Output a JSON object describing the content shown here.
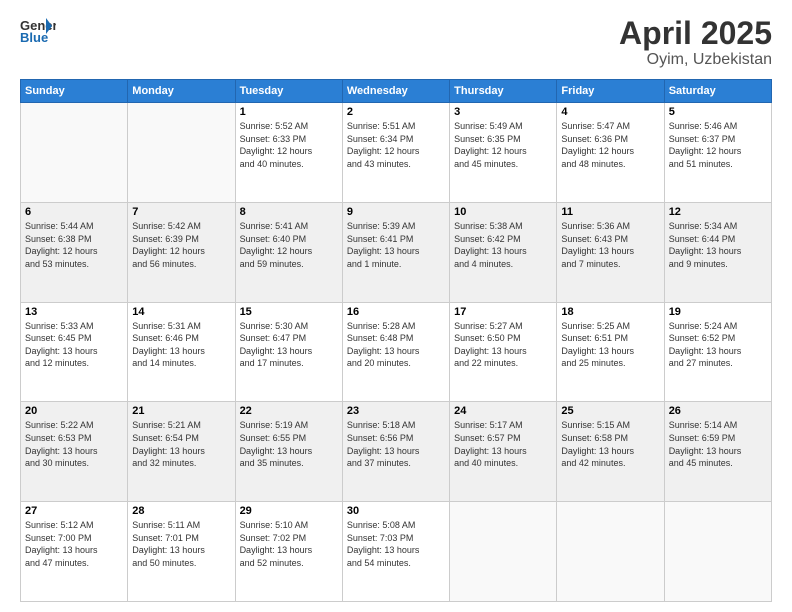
{
  "header": {
    "logo": {
      "text_general": "General",
      "text_blue": "Blue"
    },
    "title": "April 2025",
    "location": "Oyim, Uzbekistan"
  },
  "days_of_week": [
    "Sunday",
    "Monday",
    "Tuesday",
    "Wednesday",
    "Thursday",
    "Friday",
    "Saturday"
  ],
  "weeks": [
    [
      {
        "day": "",
        "info": ""
      },
      {
        "day": "",
        "info": ""
      },
      {
        "day": "1",
        "info": "Sunrise: 5:52 AM\nSunset: 6:33 PM\nDaylight: 12 hours\nand 40 minutes."
      },
      {
        "day": "2",
        "info": "Sunrise: 5:51 AM\nSunset: 6:34 PM\nDaylight: 12 hours\nand 43 minutes."
      },
      {
        "day": "3",
        "info": "Sunrise: 5:49 AM\nSunset: 6:35 PM\nDaylight: 12 hours\nand 45 minutes."
      },
      {
        "day": "4",
        "info": "Sunrise: 5:47 AM\nSunset: 6:36 PM\nDaylight: 12 hours\nand 48 minutes."
      },
      {
        "day": "5",
        "info": "Sunrise: 5:46 AM\nSunset: 6:37 PM\nDaylight: 12 hours\nand 51 minutes."
      }
    ],
    [
      {
        "day": "6",
        "info": "Sunrise: 5:44 AM\nSunset: 6:38 PM\nDaylight: 12 hours\nand 53 minutes."
      },
      {
        "day": "7",
        "info": "Sunrise: 5:42 AM\nSunset: 6:39 PM\nDaylight: 12 hours\nand 56 minutes."
      },
      {
        "day": "8",
        "info": "Sunrise: 5:41 AM\nSunset: 6:40 PM\nDaylight: 12 hours\nand 59 minutes."
      },
      {
        "day": "9",
        "info": "Sunrise: 5:39 AM\nSunset: 6:41 PM\nDaylight: 13 hours\nand 1 minute."
      },
      {
        "day": "10",
        "info": "Sunrise: 5:38 AM\nSunset: 6:42 PM\nDaylight: 13 hours\nand 4 minutes."
      },
      {
        "day": "11",
        "info": "Sunrise: 5:36 AM\nSunset: 6:43 PM\nDaylight: 13 hours\nand 7 minutes."
      },
      {
        "day": "12",
        "info": "Sunrise: 5:34 AM\nSunset: 6:44 PM\nDaylight: 13 hours\nand 9 minutes."
      }
    ],
    [
      {
        "day": "13",
        "info": "Sunrise: 5:33 AM\nSunset: 6:45 PM\nDaylight: 13 hours\nand 12 minutes."
      },
      {
        "day": "14",
        "info": "Sunrise: 5:31 AM\nSunset: 6:46 PM\nDaylight: 13 hours\nand 14 minutes."
      },
      {
        "day": "15",
        "info": "Sunrise: 5:30 AM\nSunset: 6:47 PM\nDaylight: 13 hours\nand 17 minutes."
      },
      {
        "day": "16",
        "info": "Sunrise: 5:28 AM\nSunset: 6:48 PM\nDaylight: 13 hours\nand 20 minutes."
      },
      {
        "day": "17",
        "info": "Sunrise: 5:27 AM\nSunset: 6:50 PM\nDaylight: 13 hours\nand 22 minutes."
      },
      {
        "day": "18",
        "info": "Sunrise: 5:25 AM\nSunset: 6:51 PM\nDaylight: 13 hours\nand 25 minutes."
      },
      {
        "day": "19",
        "info": "Sunrise: 5:24 AM\nSunset: 6:52 PM\nDaylight: 13 hours\nand 27 minutes."
      }
    ],
    [
      {
        "day": "20",
        "info": "Sunrise: 5:22 AM\nSunset: 6:53 PM\nDaylight: 13 hours\nand 30 minutes."
      },
      {
        "day": "21",
        "info": "Sunrise: 5:21 AM\nSunset: 6:54 PM\nDaylight: 13 hours\nand 32 minutes."
      },
      {
        "day": "22",
        "info": "Sunrise: 5:19 AM\nSunset: 6:55 PM\nDaylight: 13 hours\nand 35 minutes."
      },
      {
        "day": "23",
        "info": "Sunrise: 5:18 AM\nSunset: 6:56 PM\nDaylight: 13 hours\nand 37 minutes."
      },
      {
        "day": "24",
        "info": "Sunrise: 5:17 AM\nSunset: 6:57 PM\nDaylight: 13 hours\nand 40 minutes."
      },
      {
        "day": "25",
        "info": "Sunrise: 5:15 AM\nSunset: 6:58 PM\nDaylight: 13 hours\nand 42 minutes."
      },
      {
        "day": "26",
        "info": "Sunrise: 5:14 AM\nSunset: 6:59 PM\nDaylight: 13 hours\nand 45 minutes."
      }
    ],
    [
      {
        "day": "27",
        "info": "Sunrise: 5:12 AM\nSunset: 7:00 PM\nDaylight: 13 hours\nand 47 minutes."
      },
      {
        "day": "28",
        "info": "Sunrise: 5:11 AM\nSunset: 7:01 PM\nDaylight: 13 hours\nand 50 minutes."
      },
      {
        "day": "29",
        "info": "Sunrise: 5:10 AM\nSunset: 7:02 PM\nDaylight: 13 hours\nand 52 minutes."
      },
      {
        "day": "30",
        "info": "Sunrise: 5:08 AM\nSunset: 7:03 PM\nDaylight: 13 hours\nand 54 minutes."
      },
      {
        "day": "",
        "info": ""
      },
      {
        "day": "",
        "info": ""
      },
      {
        "day": "",
        "info": ""
      }
    ]
  ]
}
